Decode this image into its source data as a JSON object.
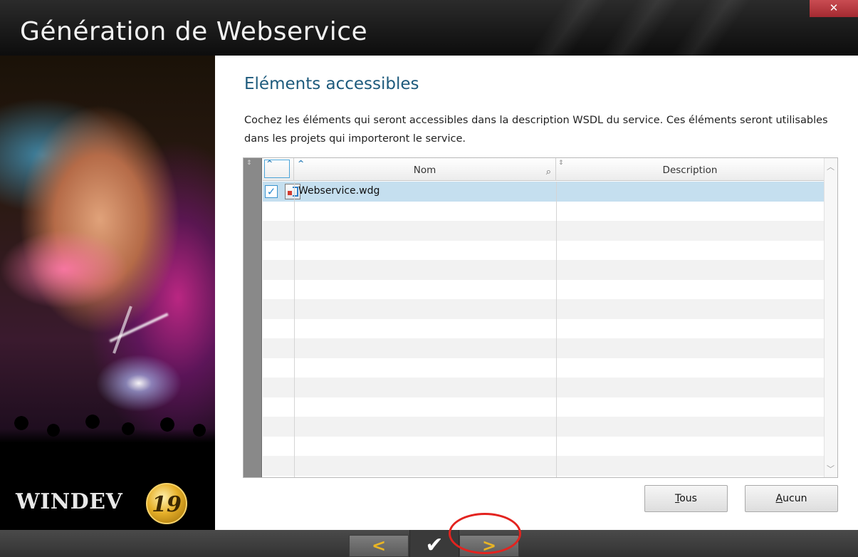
{
  "window": {
    "title": "Génération de Webservice",
    "close_glyph": "✕"
  },
  "sidebar": {
    "brand": "WINDEV",
    "version": "19"
  },
  "main": {
    "heading": "Eléments accessibles",
    "instructions": "Cochez les éléments qui seront accessibles dans la description WSDL du service. Ces éléments seront utilisables dans les projets qui importeront le service."
  },
  "table": {
    "columns": [
      {
        "label": ""
      },
      {
        "label": "Nom"
      },
      {
        "label": "Description"
      }
    ],
    "rows": [
      {
        "checked": true,
        "name": "Webservice.wdg",
        "description": ""
      }
    ],
    "empty_rows": 14
  },
  "buttons": {
    "all_prefix": "T",
    "all_rest": "ous",
    "none_prefix": "A",
    "none_rest": "ucun"
  },
  "nav": {
    "prev": "<",
    "finish": "✔",
    "next": ">"
  },
  "icons": {
    "close": "close-icon",
    "search": "search-icon",
    "file": "webservice-file-icon",
    "sort": "sort-icon"
  },
  "colors": {
    "heading": "#1d5a7c",
    "selection": "#c5dfef",
    "nav_arrows": "#e9b524",
    "highlight": "#e3231f"
  }
}
